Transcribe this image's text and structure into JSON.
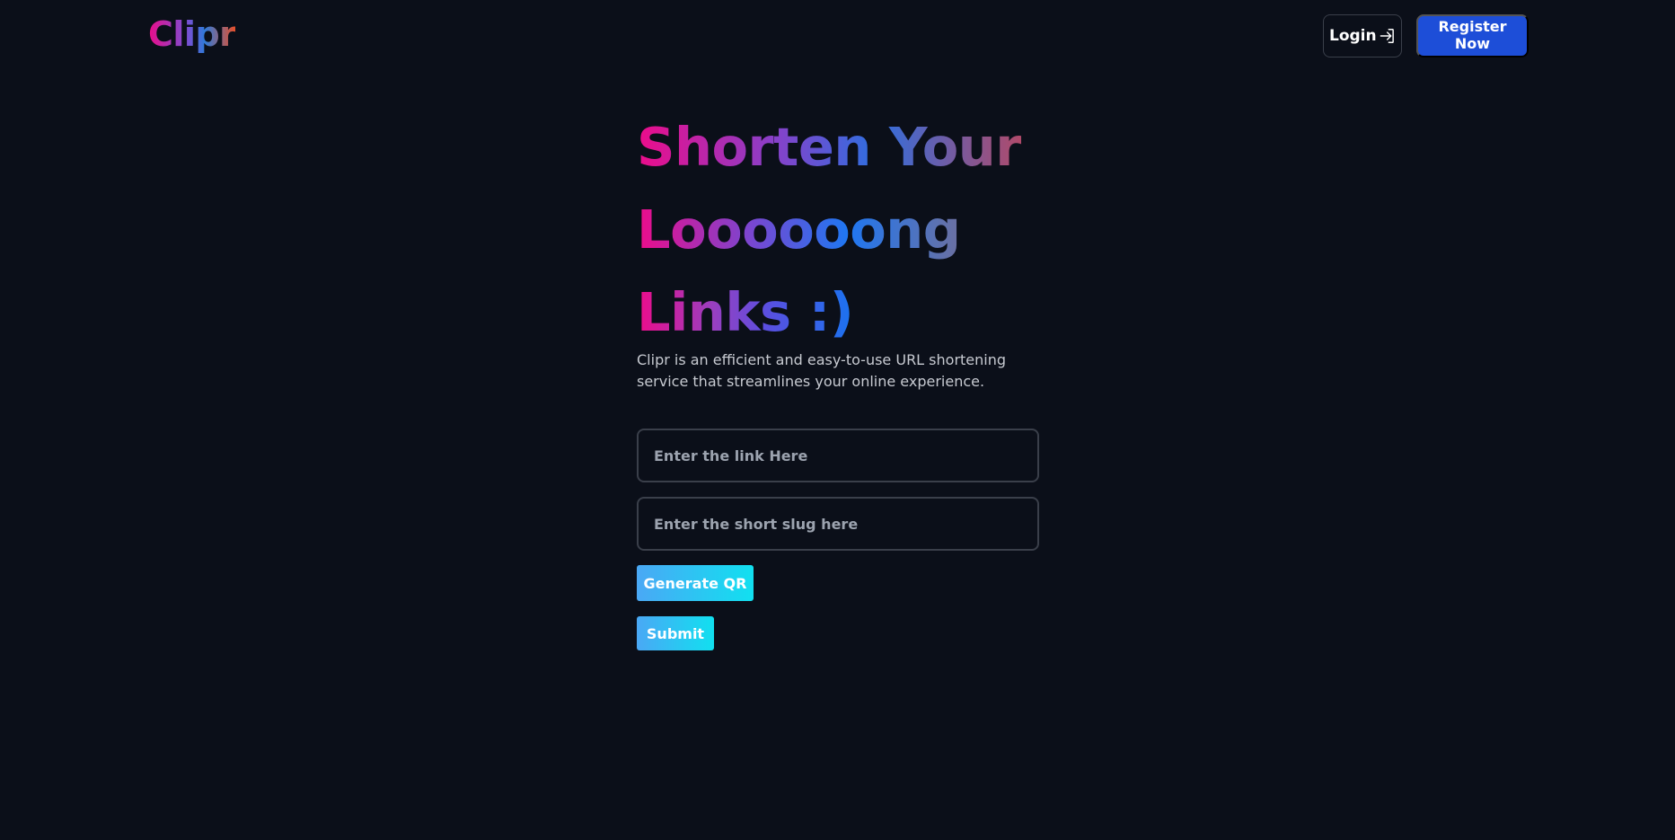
{
  "header": {
    "logo_text": "Clipr",
    "login_label": "Login",
    "register_label": "Register Now"
  },
  "hero": {
    "line1": "Shorten Your",
    "line2": "Loooooong",
    "line3": "Links :)",
    "tagline": "Clipr is an efficient and easy-to-use URL shortening service that streamlines your online experience."
  },
  "form": {
    "link_placeholder": "Enter the link Here",
    "slug_placeholder": "Enter the short slug here",
    "generate_qr_label": "Generate QR",
    "submit_label": "Submit"
  },
  "icons": {
    "login": "login-arrow-icon"
  },
  "colors": {
    "background": "#0b0f19",
    "register_button": "#1d4ed8",
    "gradient_pink": "#ec0c8a",
    "gradient_blue": "#1f77f2",
    "button_gradient_start": "#4aa8f5",
    "button_gradient_end": "#11e0f0"
  }
}
